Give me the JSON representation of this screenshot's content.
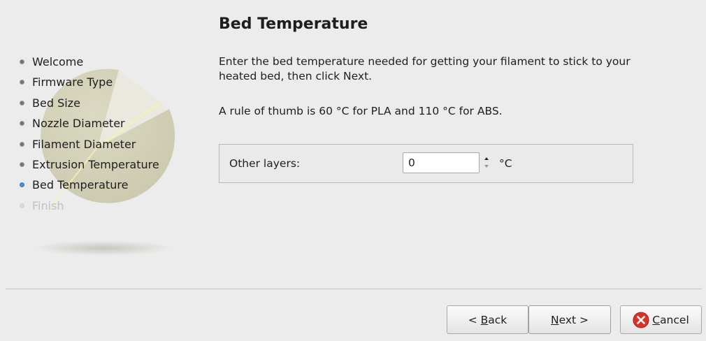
{
  "wizard": {
    "title": "Bed Temperature",
    "steps": [
      {
        "label": "Welcome",
        "state": "done"
      },
      {
        "label": "Firmware Type",
        "state": "done"
      },
      {
        "label": "Bed Size",
        "state": "done"
      },
      {
        "label": "Nozzle Diameter",
        "state": "done"
      },
      {
        "label": "Filament Diameter",
        "state": "done"
      },
      {
        "label": "Extrusion Temperature",
        "state": "done"
      },
      {
        "label": "Bed Temperature",
        "state": "current"
      },
      {
        "label": "Finish",
        "state": "pending"
      }
    ],
    "description": "Enter the bed temperature needed for getting your filament to stick to your heated bed, then click Next.",
    "rule_of_thumb": "A rule of thumb is 60 °C for PLA and 110 °C for ABS."
  },
  "form": {
    "other_layers_label": "Other layers:",
    "other_layers_value": "0",
    "unit": "°C"
  },
  "buttons": {
    "back": {
      "pre": "< ",
      "mnemonic": "B",
      "post": "ack"
    },
    "next": {
      "pre": "",
      "mnemonic": "N",
      "post": "ext >"
    },
    "cancel": {
      "pre": "",
      "mnemonic": "C",
      "post": "ancel"
    }
  },
  "icons": {
    "logo": "slic3r-logo-watermark",
    "cancel": "cancel-icon",
    "spin_up": "spin-up-icon",
    "spin_down": "spin-down-icon"
  },
  "colors": {
    "current_step_bullet": "#4a90d9",
    "cancel_icon_red": "#d9342b"
  }
}
